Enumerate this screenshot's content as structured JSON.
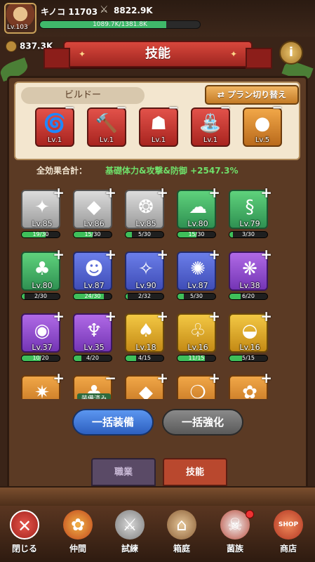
{
  "player": {
    "level": "Lv.103",
    "name": "キノコ 11703",
    "power": "8822.9K",
    "exp_text": "1089.7K/1381.8K",
    "exp_fraction": 0.789
  },
  "currency": {
    "value": "837.3K"
  },
  "title": "技能",
  "build": {
    "name": "ビルドー",
    "plan_button": "プラン切り替え",
    "equipped": [
      {
        "level": "Lv.1",
        "icon": "tornado-icon",
        "color": "red"
      },
      {
        "level": "Lv.1",
        "icon": "warrior-hammer-icon",
        "color": "red"
      },
      {
        "level": "Lv.1",
        "icon": "dark-rider-icon",
        "color": "red"
      },
      {
        "level": "Lv.1",
        "icon": "green-fountain-icon",
        "color": "red"
      },
      {
        "level": "Lv.5",
        "icon": "green-melon-icon",
        "color": "gold"
      }
    ]
  },
  "total_effect": {
    "label": "全効果合計：",
    "value": "基礎体力&攻撃&防御 +2547.3%"
  },
  "skills": [
    {
      "level": "Lv.85",
      "progress": "19/30",
      "fraction": 0.63,
      "color": "white",
      "icon": "phoenix-icon"
    },
    {
      "level": "Lv.86",
      "progress": "15/30",
      "fraction": 0.5,
      "color": "white",
      "icon": "gold-pile-icon"
    },
    {
      "level": "Lv.85",
      "progress": "5/30",
      "fraction": 0.17,
      "color": "white",
      "icon": "fire-drop-icon"
    },
    {
      "level": "Lv.80",
      "progress": "15/30",
      "fraction": 0.5,
      "color": "green",
      "icon": "ghost-icon"
    },
    {
      "level": "Lv.79",
      "progress": "3/30",
      "fraction": 0.1,
      "color": "green",
      "icon": "serpent-icon"
    },
    {
      "level": "Lv.80",
      "progress": "2/30",
      "fraction": 0.07,
      "color": "green",
      "icon": "mushroom-icon"
    },
    {
      "level": "Lv.87",
      "progress": "24/30",
      "fraction": 0.8,
      "color": "blue",
      "icon": "shadow-icon"
    },
    {
      "level": "Lv.90",
      "progress": "2/32",
      "fraction": 0.06,
      "color": "blue",
      "icon": "witch-icon"
    },
    {
      "level": "Lv.87",
      "progress": "5/30",
      "fraction": 0.17,
      "color": "blue",
      "icon": "crab-icon"
    },
    {
      "level": "Lv.38",
      "progress": "6/20",
      "fraction": 0.3,
      "color": "purple",
      "icon": "pineapple-icon"
    },
    {
      "level": "Lv.37",
      "progress": "10/20",
      "fraction": 0.5,
      "color": "purple",
      "icon": "pearl-shell-icon"
    },
    {
      "level": "Lv.35",
      "progress": "4/20",
      "fraction": 0.2,
      "color": "purple",
      "icon": "tentacle-icon"
    },
    {
      "level": "Lv.18",
      "progress": "4/15",
      "fraction": 0.27,
      "color": "gold",
      "icon": "bat-icon"
    },
    {
      "level": "Lv.16",
      "progress": "11/15",
      "fraction": 0.73,
      "color": "gold",
      "icon": "sprout-icon"
    },
    {
      "level": "Lv.16",
      "progress": "5/15",
      "fraction": 0.33,
      "color": "gold",
      "icon": "green-shell-icon"
    },
    {
      "level": "",
      "progress": "",
      "fraction": 0,
      "color": "orange",
      "icon": "flame-icon",
      "partial": true
    },
    {
      "level": "",
      "progress": "",
      "fraction": 0,
      "color": "orange",
      "icon": "equipped-plant-icon",
      "partial": true,
      "equipped_tag": "装備済み"
    },
    {
      "level": "",
      "progress": "",
      "fraction": 0,
      "color": "orange",
      "icon": "purple-crystal-icon",
      "partial": true
    },
    {
      "level": "",
      "progress": "",
      "fraction": 0,
      "color": "orange",
      "icon": "orb-icon",
      "partial": true
    },
    {
      "level": "",
      "progress": "",
      "fraction": 0,
      "color": "orange",
      "icon": "flower-icon",
      "partial": true
    }
  ],
  "actions": {
    "equip_all": "一括装備",
    "upgrade_all": "一括強化"
  },
  "tabs": {
    "job": "職業",
    "skill": "技能"
  },
  "nav": {
    "close": "閉じる",
    "companions": "仲間",
    "trial": "試練",
    "garden": "箱庭",
    "clan": "菌族",
    "shop": "商店",
    "shop_badge": "SHOP"
  },
  "colors": {
    "accent_red": "#b9482e",
    "accent_green": "#6fe06a",
    "button_blue": "#2d5fbf"
  }
}
